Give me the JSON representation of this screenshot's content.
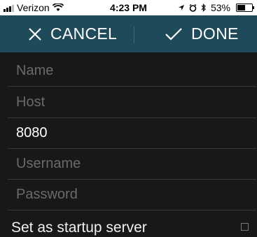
{
  "status_bar": {
    "carrier": "Verizon",
    "time": "4:23 PM",
    "battery_percent": "53%",
    "battery_level": 0.53
  },
  "action_bar": {
    "cancel_label": "CANCEL",
    "done_label": "DONE"
  },
  "form": {
    "name": {
      "value": "",
      "placeholder": "Name"
    },
    "host": {
      "value": "",
      "placeholder": "Host"
    },
    "port": {
      "value": "8080",
      "placeholder": ""
    },
    "username": {
      "value": "",
      "placeholder": "Username"
    },
    "password": {
      "value": "",
      "placeholder": "Password"
    },
    "startup_label": "Set as startup server",
    "startup_checked": false
  },
  "colors": {
    "action_bar": "#1e4a59",
    "background": "#181818"
  },
  "icons": [
    "wifi-icon",
    "location-icon",
    "alarm-icon",
    "bluetooth-icon",
    "battery-icon",
    "close-icon",
    "checkmark-icon"
  ]
}
